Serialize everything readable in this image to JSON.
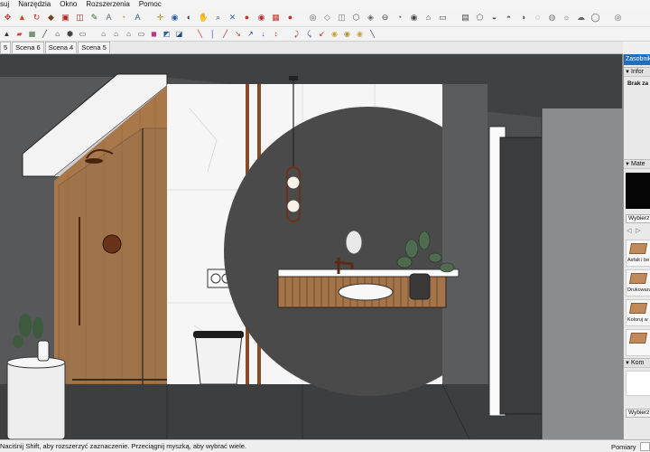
{
  "menu": [
    "suj",
    "Narzędzia",
    "Okno",
    "Rozszerzenia",
    "Pomoc"
  ],
  "toolbar1": {
    "icons": [
      {
        "name": "move-icon",
        "glyph": "✥",
        "color": "#c0392b"
      },
      {
        "name": "pushpull-icon",
        "glyph": "▲",
        "color": "#c84d1a"
      },
      {
        "name": "rotate-icon",
        "glyph": "↻",
        "color": "#d03030"
      },
      {
        "name": "followme-icon",
        "glyph": "◆",
        "color": "#7a3e1a"
      },
      {
        "name": "scale-icon",
        "glyph": "▣",
        "color": "#b22222"
      },
      {
        "name": "offset-icon",
        "glyph": "◫",
        "color": "#8b2a1f"
      },
      {
        "name": "tape-measure-icon",
        "glyph": "✎",
        "color": "#2d6a2d"
      },
      {
        "name": "dimension-icon",
        "glyph": "A",
        "color": "#5a6a7a"
      },
      {
        "name": "protractor-icon",
        "glyph": "◔",
        "color": "#c9a233"
      },
      {
        "name": "text-icon",
        "glyph": "A",
        "color": "#336699"
      },
      {
        "name": "axes-icon",
        "glyph": "✛",
        "color": "#b8860b"
      },
      {
        "name": "paint-bucket-icon",
        "glyph": "◉",
        "color": "#2a5aa8"
      },
      {
        "name": "orbit-icon",
        "glyph": "◐",
        "color": "#3a3a3a"
      },
      {
        "name": "pan-icon",
        "glyph": "✋",
        "color": "#a06030"
      },
      {
        "name": "zoom-icon",
        "glyph": "⌕",
        "color": "#2a4a8a"
      },
      {
        "name": "zoom-extents-icon",
        "glyph": "✕",
        "color": "#3a6aa0"
      },
      {
        "name": "warehouse-icon",
        "glyph": "●",
        "color": "#c0392b"
      },
      {
        "name": "extension-warehouse-icon",
        "glyph": "◉",
        "color": "#b03030"
      },
      {
        "name": "components-icon",
        "glyph": "▦",
        "color": "#c0392b"
      },
      {
        "name": "materials-icon",
        "glyph": "●",
        "color": "#c03030"
      },
      {
        "name": "view-eye-icon",
        "glyph": "◎",
        "color": "#555"
      },
      {
        "name": "xray-icon",
        "glyph": "◇",
        "color": "#777"
      },
      {
        "name": "back-edges-icon",
        "glyph": "◫",
        "color": "#777"
      },
      {
        "name": "wireframe-icon",
        "glyph": "⬡",
        "color": "#555"
      },
      {
        "name": "hidden-line-icon",
        "glyph": "◈",
        "color": "#666"
      },
      {
        "name": "shaded-icon",
        "glyph": "⊖",
        "color": "#444"
      },
      {
        "name": "shaded-textures-icon",
        "glyph": "◔",
        "color": "#555"
      },
      {
        "name": "monochrome-icon",
        "glyph": "◉",
        "color": "#444"
      },
      {
        "name": "iso-view-icon",
        "glyph": "⌂",
        "color": "#555"
      },
      {
        "name": "top-view-icon",
        "glyph": "▭",
        "color": "#444"
      },
      {
        "name": "front-view-icon",
        "glyph": "▤",
        "color": "#444"
      },
      {
        "name": "right-view-icon",
        "glyph": "⬠",
        "color": "#555"
      },
      {
        "name": "section-plane-icon",
        "glyph": "◒",
        "color": "#555"
      },
      {
        "name": "section-cut-icon",
        "glyph": "◓",
        "color": "#666"
      },
      {
        "name": "section-fill-icon",
        "glyph": "◑",
        "color": "#555"
      },
      {
        "name": "shadow-icon",
        "glyph": "◌",
        "color": "#555"
      },
      {
        "name": "fog-icon",
        "glyph": "◍",
        "color": "#777"
      },
      {
        "name": "sun-icon",
        "glyph": "☼",
        "color": "#666"
      },
      {
        "name": "cloud-icon",
        "glyph": "☁",
        "color": "#666"
      },
      {
        "name": "globe-icon",
        "glyph": "◯",
        "color": "#555"
      },
      {
        "name": "location-icon",
        "glyph": "◎",
        "color": "#666"
      }
    ]
  },
  "toolbar2": {
    "icons": [
      {
        "name": "select-icon",
        "glyph": "▲",
        "color": "#333"
      },
      {
        "name": "eraser-icon",
        "glyph": "▰",
        "color": "#d04040"
      },
      {
        "name": "layer-icon",
        "glyph": "▦",
        "color": "#3a6a3a"
      },
      {
        "name": "line-icon",
        "glyph": "╱",
        "color": "#333"
      },
      {
        "name": "house-icon",
        "glyph": "⌂",
        "color": "#333"
      },
      {
        "name": "iso-icon",
        "glyph": "⬢",
        "color": "#444"
      },
      {
        "name": "top-icon",
        "glyph": "▭",
        "color": "#444"
      },
      {
        "name": "front-icon",
        "glyph": "⌂",
        "color": "#444"
      },
      {
        "name": "right-icon",
        "glyph": "⌂",
        "color": "#444"
      },
      {
        "name": "back-icon",
        "glyph": "⌂",
        "color": "#444"
      },
      {
        "name": "left-icon",
        "glyph": "▭",
        "color": "#444"
      },
      {
        "name": "color-by-layer-icon",
        "glyph": "◼",
        "color": "#c03090"
      },
      {
        "name": "style-1-icon",
        "glyph": "◩",
        "color": "#2a5aa8"
      },
      {
        "name": "style-2-icon",
        "glyph": "◪",
        "color": "#1a4a90"
      },
      {
        "name": "axis-red-icon",
        "glyph": "╲",
        "color": "#d02020"
      },
      {
        "name": "axis-blue-icon",
        "glyph": "│",
        "color": "#2040d0"
      },
      {
        "name": "axis-green-icon",
        "glyph": "╱",
        "color": "#c02020"
      },
      {
        "name": "dim-1-icon",
        "glyph": "↘",
        "color": "#c03030"
      },
      {
        "name": "dim-2-icon",
        "glyph": "↗",
        "color": "#2040c0"
      },
      {
        "name": "dim-3-icon",
        "glyph": "↓",
        "color": "#2040c0"
      },
      {
        "name": "dim-4-icon",
        "glyph": "↕",
        "color": "#c02020"
      },
      {
        "name": "dim-5-icon",
        "glyph": "⤸",
        "color": "#c02020"
      },
      {
        "name": "dim-6-icon",
        "glyph": "⤹",
        "color": "#2040c0"
      },
      {
        "name": "dim-7-icon",
        "glyph": "↙",
        "color": "#c02020"
      },
      {
        "name": "ext-1-icon",
        "glyph": "◉",
        "color": "#c9a233"
      },
      {
        "name": "ext-2-icon",
        "glyph": "◉",
        "color": "#b89030"
      },
      {
        "name": "ext-3-icon",
        "glyph": "◉",
        "color": "#c9a233"
      },
      {
        "name": "pencil-icon",
        "glyph": "╲",
        "color": "#333"
      }
    ]
  },
  "tabs": [
    "5",
    "Scena 6",
    "Scena 4",
    "Scena 5"
  ],
  "tray": {
    "title": "Zasobnik",
    "info_header": "Infor",
    "info_text": "Brak za",
    "materials_header": "Mate",
    "select_label": "Wybierz",
    "materials": [
      "Asfalt i be",
      "Drukowan",
      "Koloruj w",
      ""
    ],
    "components_header": "Kom",
    "select_label_2": "Wybierz"
  },
  "status": {
    "text": "Naciśnij Shift, aby rozszerzyć zaznaczenie. Przeciągnij myszką, aby wybrać wiele.",
    "measure_label": "Pomiary",
    "measure_value": ""
  }
}
